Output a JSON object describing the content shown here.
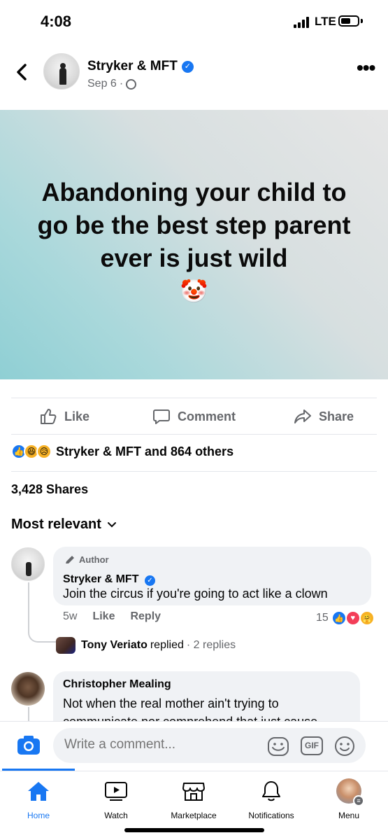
{
  "status_bar": {
    "time": "4:08",
    "network": "LTE"
  },
  "header": {
    "page_name": "Stryker & MFT",
    "date": "Sep 6",
    "separator": "·"
  },
  "post": {
    "text": "Abandoning your child to go be the best step parent ever is just wild",
    "emoji": "🤡"
  },
  "actions": {
    "like": "Like",
    "comment": "Comment",
    "share": "Share"
  },
  "reactions": {
    "summary": "Stryker & MFT and 864 others"
  },
  "shares": "3,428 Shares",
  "sort": {
    "label": "Most relevant"
  },
  "comments": [
    {
      "badge": "Author",
      "name": "Stryker & MFT",
      "text": "Join the circus if you're going to act like a clown",
      "time": "5w",
      "like": "Like",
      "reply": "Reply",
      "reaction_count": "15",
      "replies": {
        "name": "Tony Veriato",
        "verb": "replied",
        "count": "· 2 replies"
      }
    },
    {
      "name": "Christopher Mealing",
      "text": "Not when the real mother ain't trying to communicate nor comprehend that just cause"
    }
  ],
  "composer": {
    "placeholder": "Write a comment...",
    "gif": "GIF"
  },
  "tabs": [
    {
      "label": "Home",
      "active": true
    },
    {
      "label": "Watch"
    },
    {
      "label": "Marketplace"
    },
    {
      "label": "Notifications"
    },
    {
      "label": "Menu"
    }
  ],
  "colors": {
    "accent": "#1877f2",
    "muted": "#65676b",
    "bubble": "#f0f2f5"
  }
}
